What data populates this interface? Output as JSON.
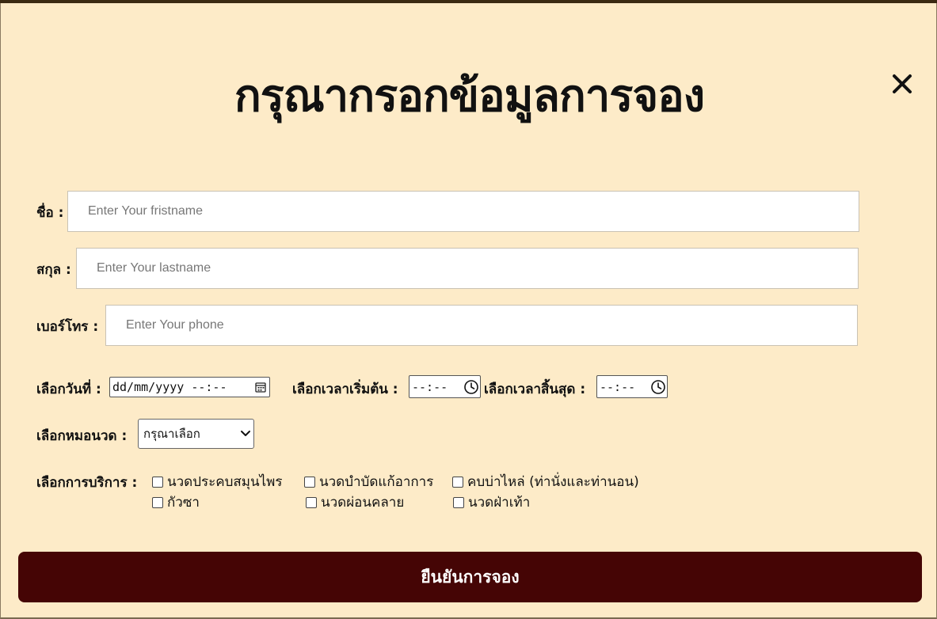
{
  "form": {
    "title": "กรุณากรอกข้อมูลการจอง",
    "firstname": {
      "label": "ชื่อ :",
      "placeholder": "Enter Your fristname"
    },
    "lastname": {
      "label": "สกุล :",
      "placeholder": "Enter Your lastname"
    },
    "phone": {
      "label": "เบอร์โทร :",
      "placeholder": "Enter Your phone"
    },
    "date": {
      "label": "เลือกวันที่ :",
      "value": "dd/mm/yyyy --:--"
    },
    "start_time": {
      "label": "เลือกเวลาเริ่มต้น :",
      "value": "--:--"
    },
    "end_time": {
      "label": "เลือกเวลาสิ้นสุด :",
      "value": "--:--"
    },
    "therapist": {
      "label": "เลือกหมอนวด :",
      "selected": "กรุณาเลือก"
    },
    "services": {
      "label": "เลือกการบริการ :",
      "options": [
        "นวดประคบสมุนไพร",
        "นวดบำบัดแก้อาการ",
        "คบบ่าไหล่ (ท่านั่งและท่านอน)",
        "กัวซา",
        "นวดผ่อนคลาย",
        "นวดฝ่าเท้า"
      ]
    },
    "submit_label": "ยืนยันการจอง"
  },
  "icons": {
    "close": "close-icon",
    "calendar": "calendar-icon",
    "clock": "clock-icon",
    "chevron": "chevron-down-icon"
  },
  "colors": {
    "background": "#fdebc8",
    "submit_button": "#450505",
    "submit_text": "#ffffff"
  }
}
